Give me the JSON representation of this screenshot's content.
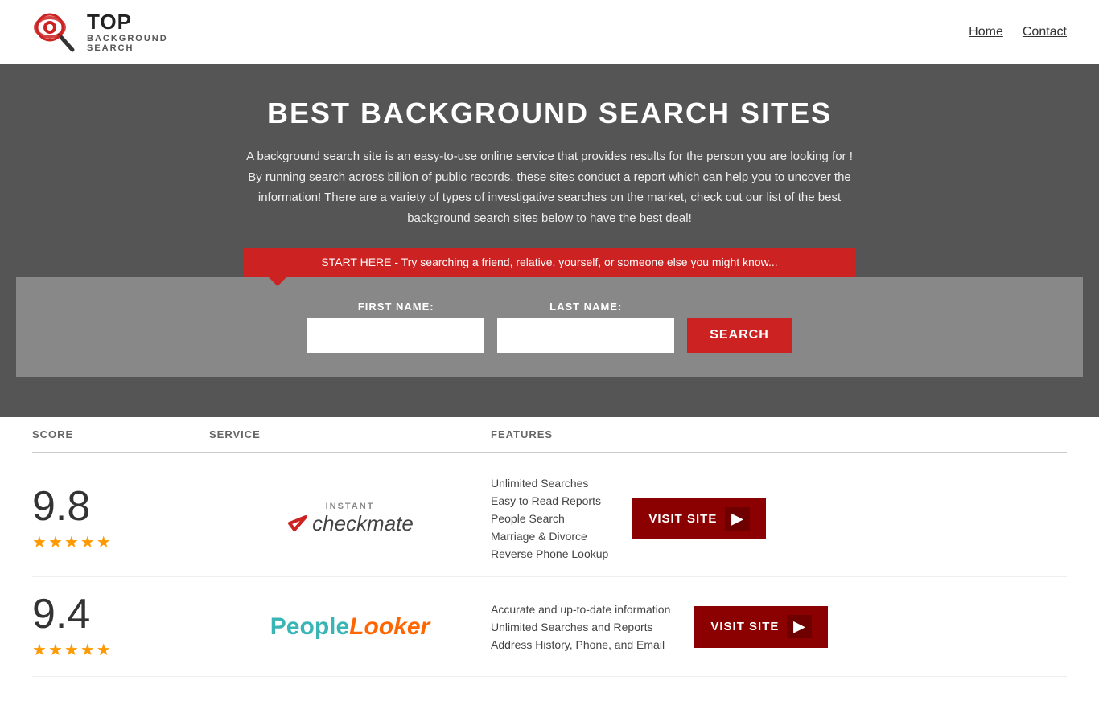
{
  "site": {
    "title": "Top Background Search",
    "logo_top": "TOP",
    "logo_bottom": "BACKGROUND\nSEARCH"
  },
  "nav": {
    "home_label": "Home",
    "contact_label": "Contact"
  },
  "hero": {
    "heading": "BEST BACKGROUND SEARCH SITES",
    "description": "A background search site is an easy-to-use online service that provides results  for the person you are looking for ! By  running  search across billion of public records, these sites conduct  a report which can help you to uncover the information! There are a variety of types of investigative searches on the market, check out our  list of the best background search sites below to have the best deal!",
    "banner_text": "START HERE - Try searching a friend, relative, yourself, or someone else you might know..."
  },
  "search_form": {
    "first_name_label": "FIRST NAME:",
    "last_name_label": "LAST NAME:",
    "button_label": "SEARCH"
  },
  "table": {
    "col_score": "SCORE",
    "col_service": "SERVICE",
    "col_features": "FEATURES"
  },
  "results": [
    {
      "id": 1,
      "score": "9.8",
      "stars": 4.5,
      "service_name": "Instant Checkmate",
      "features": [
        "Unlimited Searches",
        "Easy to Read Reports",
        "People Search",
        "Marriage & Divorce",
        "Reverse Phone Lookup"
      ],
      "visit_label": "VISIT SITE"
    },
    {
      "id": 2,
      "score": "9.4",
      "stars": 4.5,
      "service_name": "PeopleLooker",
      "features": [
        "Accurate and up-to-date information",
        "Unlimited Searches and Reports",
        "Address History, Phone, and Email"
      ],
      "visit_label": "VISIT SITE"
    }
  ]
}
